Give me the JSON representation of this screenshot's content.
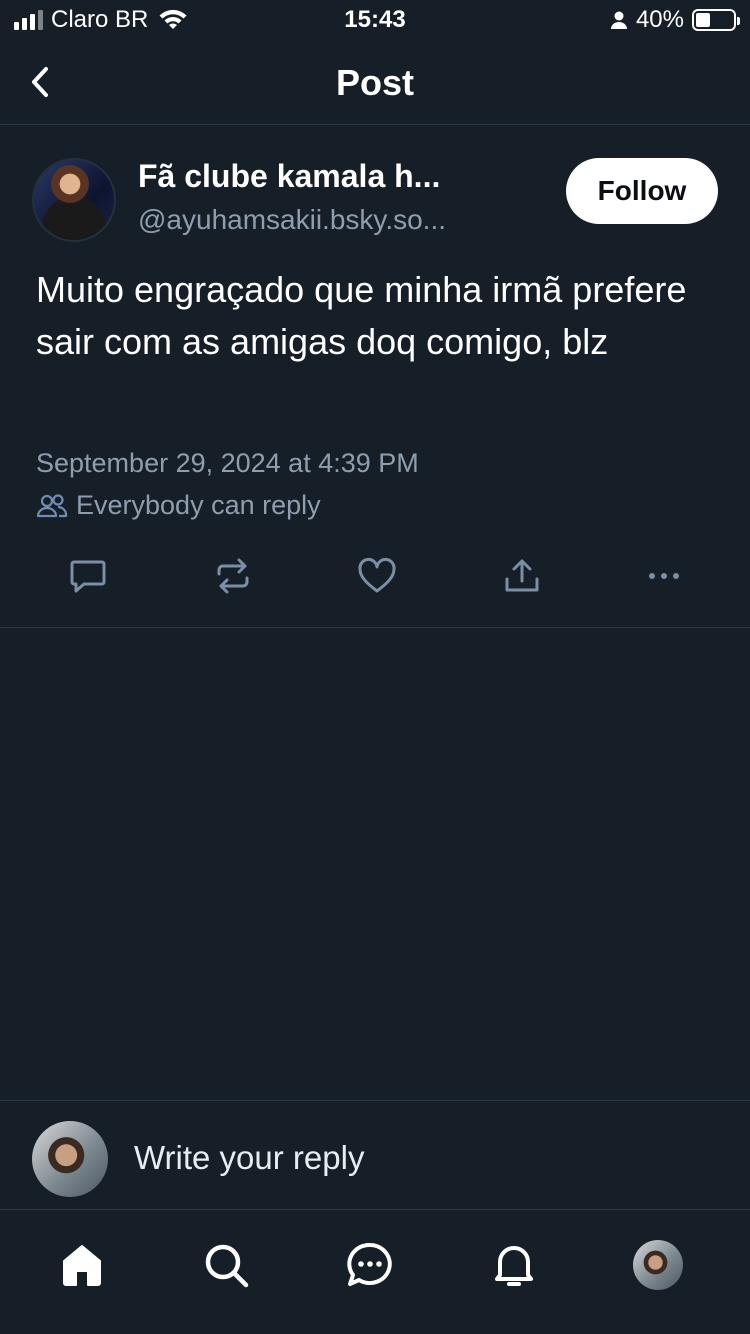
{
  "status_bar": {
    "carrier": "Claro BR",
    "time": "15:43",
    "battery": "40%",
    "battery_level": 0.4
  },
  "header": {
    "title": "Post",
    "back_icon": "chevron-left-icon"
  },
  "post": {
    "author_name": "Fã clube kamala h...",
    "author_handle": "@ayuhamsakii.bsky.so...",
    "follow_label": "Follow",
    "text": "Muito engraçado que minha irmã prefere sair com as amigas doq comigo, blz",
    "date": "September 29, 2024 at 4:39 PM",
    "reply_setting": "Everybody can reply",
    "actions": [
      "reply-icon",
      "repost-icon",
      "like-icon",
      "share-icon",
      "more-icon"
    ]
  },
  "reply": {
    "placeholder": "Write your reply"
  },
  "tabs": [
    "home-icon",
    "search-icon",
    "chat-icon",
    "notifications-icon",
    "profile-avatar"
  ],
  "colors": {
    "background": "#161e27",
    "divider": "#2c3642",
    "secondary_text": "#8f9eae",
    "icon": "#7a8fa6"
  }
}
